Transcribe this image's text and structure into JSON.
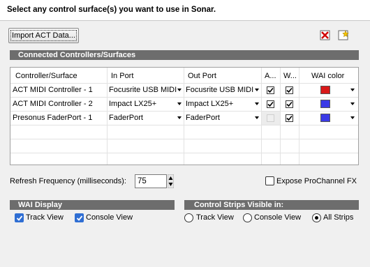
{
  "header": {
    "title": "Select any control surface(s) you want to use in Sonar."
  },
  "toolbar": {
    "import_label": "Import ACT Data..."
  },
  "connected": {
    "title": "Connected Controllers/Surfaces",
    "columns": [
      "Controller/Surface",
      "In Port",
      "Out Port",
      "A...",
      "W...",
      "WAI color"
    ],
    "rows": [
      {
        "name": "ACT MIDI Controller - 1",
        "in_port": "Focusrite USB MIDI",
        "out_port": "Focusrite USB MIDI",
        "a": true,
        "w": true,
        "a_enabled": true,
        "color": "#d81818"
      },
      {
        "name": "ACT MIDI Controller - 2",
        "in_port": "Impact LX25+",
        "out_port": "Impact LX25+",
        "a": true,
        "w": true,
        "a_enabled": true,
        "color": "#3a3ae6"
      },
      {
        "name": "Presonus FaderPort - 1",
        "in_port": "FaderPort",
        "out_port": "FaderPort",
        "a": false,
        "w": true,
        "a_enabled": false,
        "color": "#3a3ae6"
      }
    ]
  },
  "refresh": {
    "label": "Refresh Frequency (milliseconds):",
    "value": "75"
  },
  "expose": {
    "label": "Expose ProChannel FX",
    "checked": false
  },
  "wai_display": {
    "title": "WAI Display",
    "track_view": "Track View",
    "console_view": "Console View"
  },
  "control_strips": {
    "title": "Control Strips Visible in:",
    "track_view": "Track View",
    "console_view": "Console View",
    "all_strips": "All Strips",
    "selected": "All Strips"
  },
  "colors": {
    "section_header": "#6d6d6d",
    "checkbox_blue": "#2f6ed3"
  }
}
